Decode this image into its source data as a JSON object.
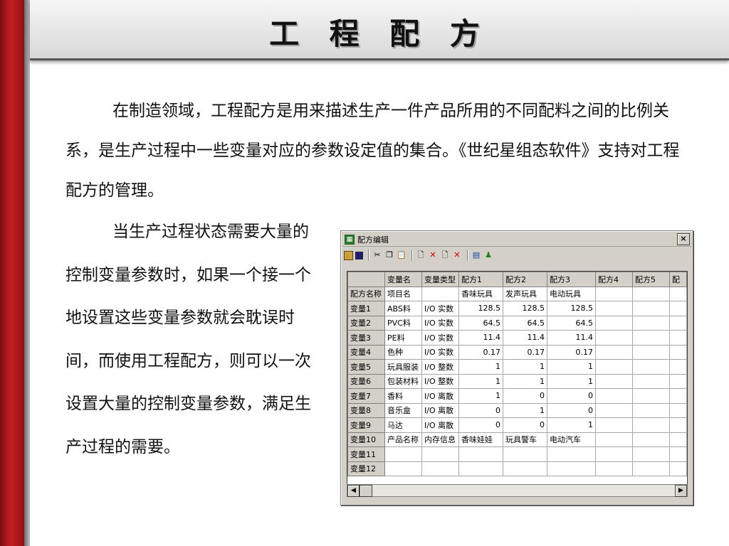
{
  "slide": {
    "title": "工 程 配 方",
    "paragraph1": "在制造领域，工程配方是用来描述生产一件产品所用的不同配料之间的比例关系，是生产过程中一些变量对应的参数设定值的集合。《世纪星组态软件》支持对工程配方的管理。",
    "paragraph2": "当生产过程状态需要大量的控制变量参数时，如果一个接一个地设置这些变量参数就会耽误时间，而使用工程配方，则可以一次设置大量的控制变量参数，满足生产过程的需要。"
  },
  "window": {
    "title": "配方编辑",
    "close": "×",
    "toolbar_icons": [
      "table-icon",
      "save-icon",
      "cut-icon",
      "copy-icon",
      "paste-icon",
      "new-doc-icon",
      "delete-icon",
      "doc-icon",
      "delete-red-icon",
      "grid-icon",
      "user-icon"
    ],
    "columns": [
      "",
      "变量名",
      "变量类型",
      "配方1",
      "配方2",
      "配方3",
      "配方4",
      "配方5",
      "配"
    ],
    "rows": [
      {
        "header": "配方名称",
        "cells": [
          "项目名",
          "",
          "香味玩具",
          "发声玩具",
          "电动玩具",
          "",
          ""
        ]
      },
      {
        "header": "变量1",
        "cells": [
          "ABS料",
          "I/O 实数",
          "128.5",
          "128.5",
          "128.5",
          "",
          ""
        ]
      },
      {
        "header": "变量2",
        "cells": [
          "PVC料",
          "I/O 实数",
          "64.5",
          "64.5",
          "64.5",
          "",
          ""
        ]
      },
      {
        "header": "变量3",
        "cells": [
          "PE料",
          "I/O 实数",
          "11.4",
          "11.4",
          "11.4",
          "",
          ""
        ]
      },
      {
        "header": "变量4",
        "cells": [
          "色种",
          "I/O 实数",
          "0.17",
          "0.17",
          "0.17",
          "",
          ""
        ]
      },
      {
        "header": "变量5",
        "cells": [
          "玩具服装",
          "I/O 整数",
          "1",
          "1",
          "1",
          "",
          ""
        ]
      },
      {
        "header": "变量6",
        "cells": [
          "包装材料",
          "I/O 整数",
          "1",
          "1",
          "1",
          "",
          ""
        ]
      },
      {
        "header": "变量7",
        "cells": [
          "香料",
          "I/O 离散",
          "1",
          "0",
          "0",
          "",
          ""
        ]
      },
      {
        "header": "变量8",
        "cells": [
          "音乐盒",
          "I/O 离散",
          "0",
          "1",
          "0",
          "",
          ""
        ]
      },
      {
        "header": "变量9",
        "cells": [
          "马达",
          "I/O 离散",
          "0",
          "0",
          "1",
          "",
          ""
        ]
      },
      {
        "header": "变量10",
        "cells": [
          "产品名称",
          "内存信息",
          "香味娃娃",
          "玩具警车",
          "电动汽车",
          "",
          ""
        ]
      },
      {
        "header": "变量11",
        "cells": [
          "",
          "",
          "",
          "",
          "",
          "",
          ""
        ]
      },
      {
        "header": "变量12",
        "cells": [
          "",
          "",
          "",
          "",
          "",
          "",
          ""
        ]
      }
    ],
    "scroll_left": "◀",
    "scroll_right": "▶"
  }
}
